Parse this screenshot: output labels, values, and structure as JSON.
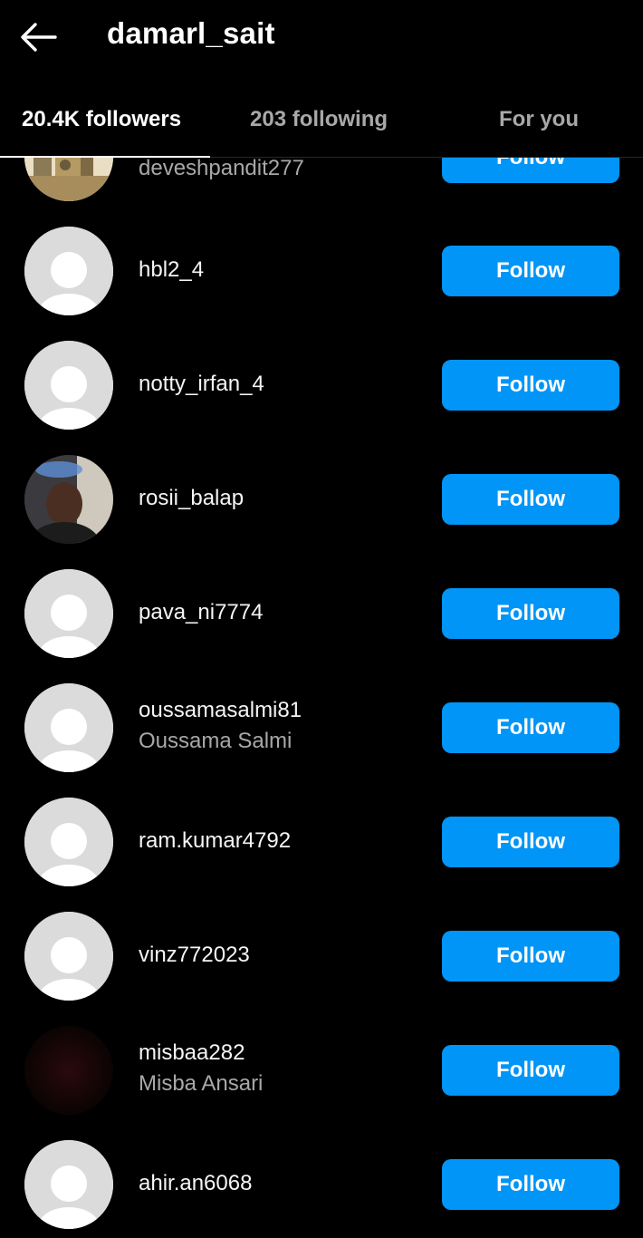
{
  "header": {
    "title": "damarl_sait",
    "back_icon": "arrow-left-icon"
  },
  "tabs": [
    {
      "label": "20.4K followers",
      "active": true
    },
    {
      "label": "203 following",
      "active": false
    },
    {
      "label": "For you",
      "active": false
    }
  ],
  "follow_label": "Follow",
  "followers": [
    {
      "username": "",
      "fullname": "deveshpandit277",
      "avatar": "photo",
      "follow_label": "Follow"
    },
    {
      "username": "hbl2_4",
      "fullname": "",
      "avatar": "default",
      "follow_label": "Follow"
    },
    {
      "username": "notty_irfan_4",
      "fullname": "",
      "avatar": "default",
      "follow_label": "Follow"
    },
    {
      "username": "rosii_balap",
      "fullname": "",
      "avatar": "photo",
      "follow_label": "Follow"
    },
    {
      "username": "pava_ni7774",
      "fullname": "",
      "avatar": "default",
      "follow_label": "Follow"
    },
    {
      "username": "oussamasalmi81",
      "fullname": "Oussama Salmi",
      "avatar": "default",
      "follow_label": "Follow"
    },
    {
      "username": "ram.kumar4792",
      "fullname": "",
      "avatar": "default",
      "follow_label": "Follow"
    },
    {
      "username": "vinz772023",
      "fullname": "",
      "avatar": "default",
      "follow_label": "Follow"
    },
    {
      "username": "misbaa282",
      "fullname": "Misba Ansari",
      "avatar": "dark",
      "follow_label": "Follow"
    },
    {
      "username": "ahir.an6068",
      "fullname": "",
      "avatar": "default",
      "follow_label": "Follow"
    }
  ],
  "colors": {
    "background": "#000000",
    "follow_button": "#0095f6",
    "secondary_text": "#a8a8a8",
    "default_avatar": "#dbdbdb"
  }
}
